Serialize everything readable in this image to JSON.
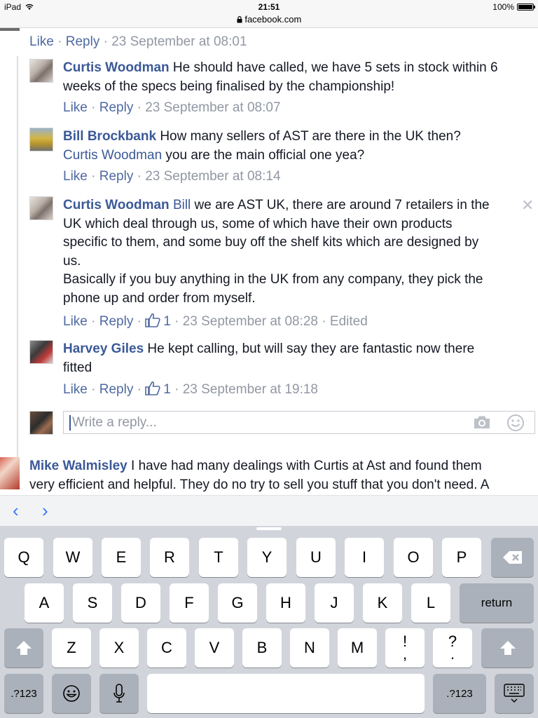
{
  "status_bar": {
    "device": "iPad",
    "time": "21:51",
    "url": "facebook.com",
    "battery": "100%"
  },
  "top_actions": {
    "like": "Like",
    "reply": "Reply",
    "time": "23 September at 08:01"
  },
  "comments": [
    {
      "author": "Curtis Woodman",
      "line1": " He should have called, we have 5 sets in stock within 6",
      "line2": "weeks of the specs being finalised by the championship!",
      "like": "Like",
      "reply": "Reply",
      "time": "23 September at 08:07"
    },
    {
      "author": "Bill Brockbank",
      "line1": " How many sellers of AST are there in the UK then?",
      "mention": "Curtis Woodman",
      "line2": " you are the main official one yea?",
      "like": "Like",
      "reply": "Reply",
      "time": "23 September at 08:14"
    },
    {
      "author": "Curtis Woodman",
      "mention": "Bill",
      "line1": " we are AST UK, there are around 7 retailers in the",
      "line2": "UK which deal through us, some of which have their own products",
      "line3": "specific to them, and some buy off the shelf kits which are designed by",
      "line4": "us.",
      "line5": "Basically if you buy anything in the UK from any company, they pick the",
      "line6": "phone up and order from myself.",
      "like": "Like",
      "reply": "Reply",
      "likes": "1",
      "time": "23 September at 08:28",
      "edited": "Edited"
    },
    {
      "author": "Harvey Giles",
      "line1": " He kept calling, but will say they are fantastic now there",
      "line2": "fitted",
      "like": "Like",
      "reply": "Reply",
      "likes": "1",
      "time": "23 September at 19:18"
    }
  ],
  "reply_box": {
    "placeholder": "Write a reply..."
  },
  "mike_comment": {
    "author": "Mike Walmisley",
    "line1": " I have had many dealings with Curtis at Ast and found them",
    "line2": "very efficient and helpful. They do no try to sell you stuff that you don't need. A"
  },
  "toolbar": {
    "prev": "‹",
    "next": "›"
  },
  "keyboard": {
    "row1": [
      "Q",
      "W",
      "E",
      "R",
      "T",
      "Y",
      "U",
      "I",
      "O",
      "P"
    ],
    "row2": [
      "A",
      "S",
      "D",
      "F",
      "G",
      "H",
      "J",
      "K",
      "L"
    ],
    "return": "return",
    "row3": [
      "Z",
      "X",
      "C",
      "V",
      "B",
      "N",
      "M"
    ],
    "punc1_top": "!",
    "punc1_bottom": ",",
    "punc2_top": "?",
    "punc2_bottom": ".",
    "numbers": ".?123"
  },
  "icon_names": [
    "wifi-icon",
    "lock-icon",
    "battery-icon",
    "like-thumb-icon",
    "close-icon",
    "camera-icon",
    "emoji-icon",
    "backspace-icon",
    "shift-icon",
    "microphone-icon",
    "keyboard-dismiss-icon"
  ]
}
